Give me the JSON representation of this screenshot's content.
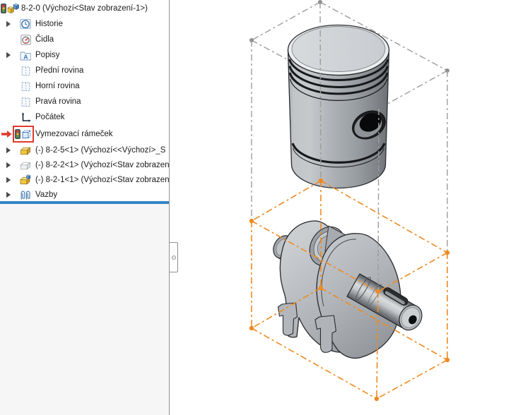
{
  "feature_tree": {
    "items": [
      {
        "label": "8-2-0 (Výchozí<Stav zobrazení-1>)",
        "icon": "assembly-traffic-light",
        "expandable": false
      },
      {
        "label": "Historie",
        "icon": "history-folder",
        "expandable": true
      },
      {
        "label": "Čidla",
        "icon": "sensors-gauge",
        "expandable": false
      },
      {
        "label": "Popisy",
        "icon": "annotations-folder",
        "expandable": true
      },
      {
        "label": "Přední rovina",
        "icon": "reference-plane",
        "expandable": false
      },
      {
        "label": "Horní rovina",
        "icon": "reference-plane",
        "expandable": false
      },
      {
        "label": "Pravá rovina",
        "icon": "reference-plane",
        "expandable": false
      },
      {
        "label": "Počátek",
        "icon": "origin-axes",
        "expandable": false
      },
      {
        "label": "Vymezovací rámeček",
        "icon": "bounding-box",
        "expandable": false,
        "highlighted": true
      },
      {
        "label": "(-) 8-2-5<1> (Výchozí<<Výchozí>_S",
        "icon": "part-yellow",
        "expandable": true
      },
      {
        "label": "(-) 8-2-2<1> (Výchozí<Stav zobrazen",
        "icon": "part-hidden",
        "expandable": true
      },
      {
        "label": "(-) 8-2-1<1> (Výchozí<Stav zobrazen",
        "icon": "part-yellow-cube",
        "expandable": true
      },
      {
        "label": "Vazby",
        "icon": "mates-paperclips",
        "expandable": true
      }
    ],
    "colors": {
      "divider_blue": "#3585c5",
      "annotation_red": "#e13a2d",
      "text": "#1a1a1a"
    }
  },
  "viewport": {
    "background": "#ffffff",
    "assembly_bounding_box_color": "#9b9b9b",
    "highlighted_bounding_box_color": "#ee8a1f",
    "visible_parts": [
      "piston",
      "crankshaft"
    ]
  }
}
